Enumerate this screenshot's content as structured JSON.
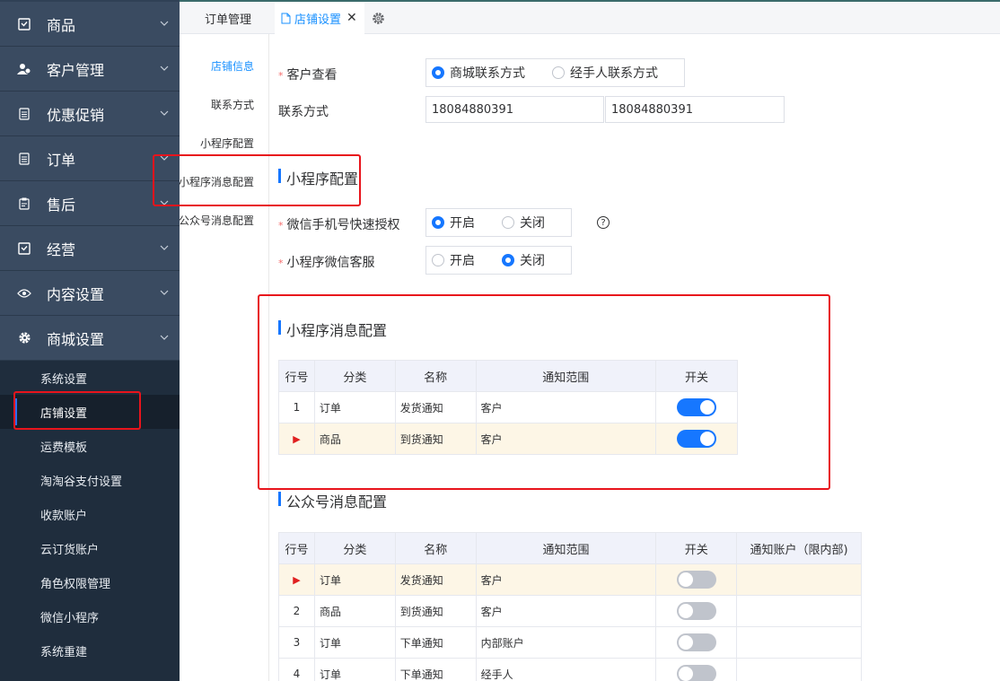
{
  "sidebar": {
    "menu": [
      {
        "label": "商品",
        "icon": "clipboard-check-icon"
      },
      {
        "label": "客户管理",
        "icon": "users-icon"
      },
      {
        "label": "优惠促销",
        "icon": "list-doc-icon"
      },
      {
        "label": "订单",
        "icon": "list-doc-icon"
      },
      {
        "label": "售后",
        "icon": "clipboard-icon"
      },
      {
        "label": "经营",
        "icon": "clipboard-check-icon"
      },
      {
        "label": "内容设置",
        "icon": "eye-icon"
      },
      {
        "label": "商城设置",
        "icon": "gear-icon"
      }
    ],
    "submenu": [
      "系统设置",
      "店铺设置",
      "运费模板",
      "淘淘谷支付设置",
      "收款账户",
      "云订货账户",
      "角色权限管理",
      "微信小程序",
      "系统重建"
    ]
  },
  "tabs": {
    "items": [
      {
        "label": "订单管理"
      },
      {
        "label": "店铺设置"
      }
    ],
    "close_glyph": "✕"
  },
  "subnav": [
    "店铺信息",
    "联系方式",
    "小程序配置",
    "小程序消息配置",
    "公众号消息配置"
  ],
  "form": {
    "customer_view_label": "客户查看",
    "customer_view_options": [
      "商城联系方式",
      "经手人联系方式"
    ],
    "contact_label": "联系方式",
    "contact_values": [
      "18084880391",
      "18084880391"
    ]
  },
  "miniprogram": {
    "title": "小程序配置",
    "phone_auth_label": "微信手机号快速授权",
    "phone_auth_options": [
      "开启",
      "关闭"
    ],
    "service_label": "小程序微信客服",
    "service_options": [
      "开启",
      "关闭"
    ],
    "help_glyph": "?"
  },
  "mp_messages": {
    "title": "小程序消息配置",
    "columns": [
      "行号",
      "分类",
      "名称",
      "通知范围",
      "开关"
    ],
    "rows": [
      {
        "no": "1",
        "category": "订单",
        "name": "发货通知",
        "scope": "客户",
        "on": true
      },
      {
        "no": "",
        "category": "商品",
        "name": "到货通知",
        "scope": "客户",
        "on": true,
        "current": true
      }
    ]
  },
  "oa_messages": {
    "title": "公众号消息配置",
    "columns": [
      "行号",
      "分类",
      "名称",
      "通知范围",
      "开关",
      "通知账户（限内部)"
    ],
    "rows": [
      {
        "no": "",
        "category": "订单",
        "name": "发货通知",
        "scope": "客户",
        "on": false,
        "current": true
      },
      {
        "no": "2",
        "category": "商品",
        "name": "到货通知",
        "scope": "客户",
        "on": false
      },
      {
        "no": "3",
        "category": "订单",
        "name": "下单通知",
        "scope": "内部账户",
        "on": false
      },
      {
        "no": "4",
        "category": "订单",
        "name": "下单通知",
        "scope": "经手人",
        "on": false
      }
    ]
  },
  "colors": {
    "accent": "#1677ff",
    "sidebar": "#304156",
    "annotation": "#e8141c"
  }
}
